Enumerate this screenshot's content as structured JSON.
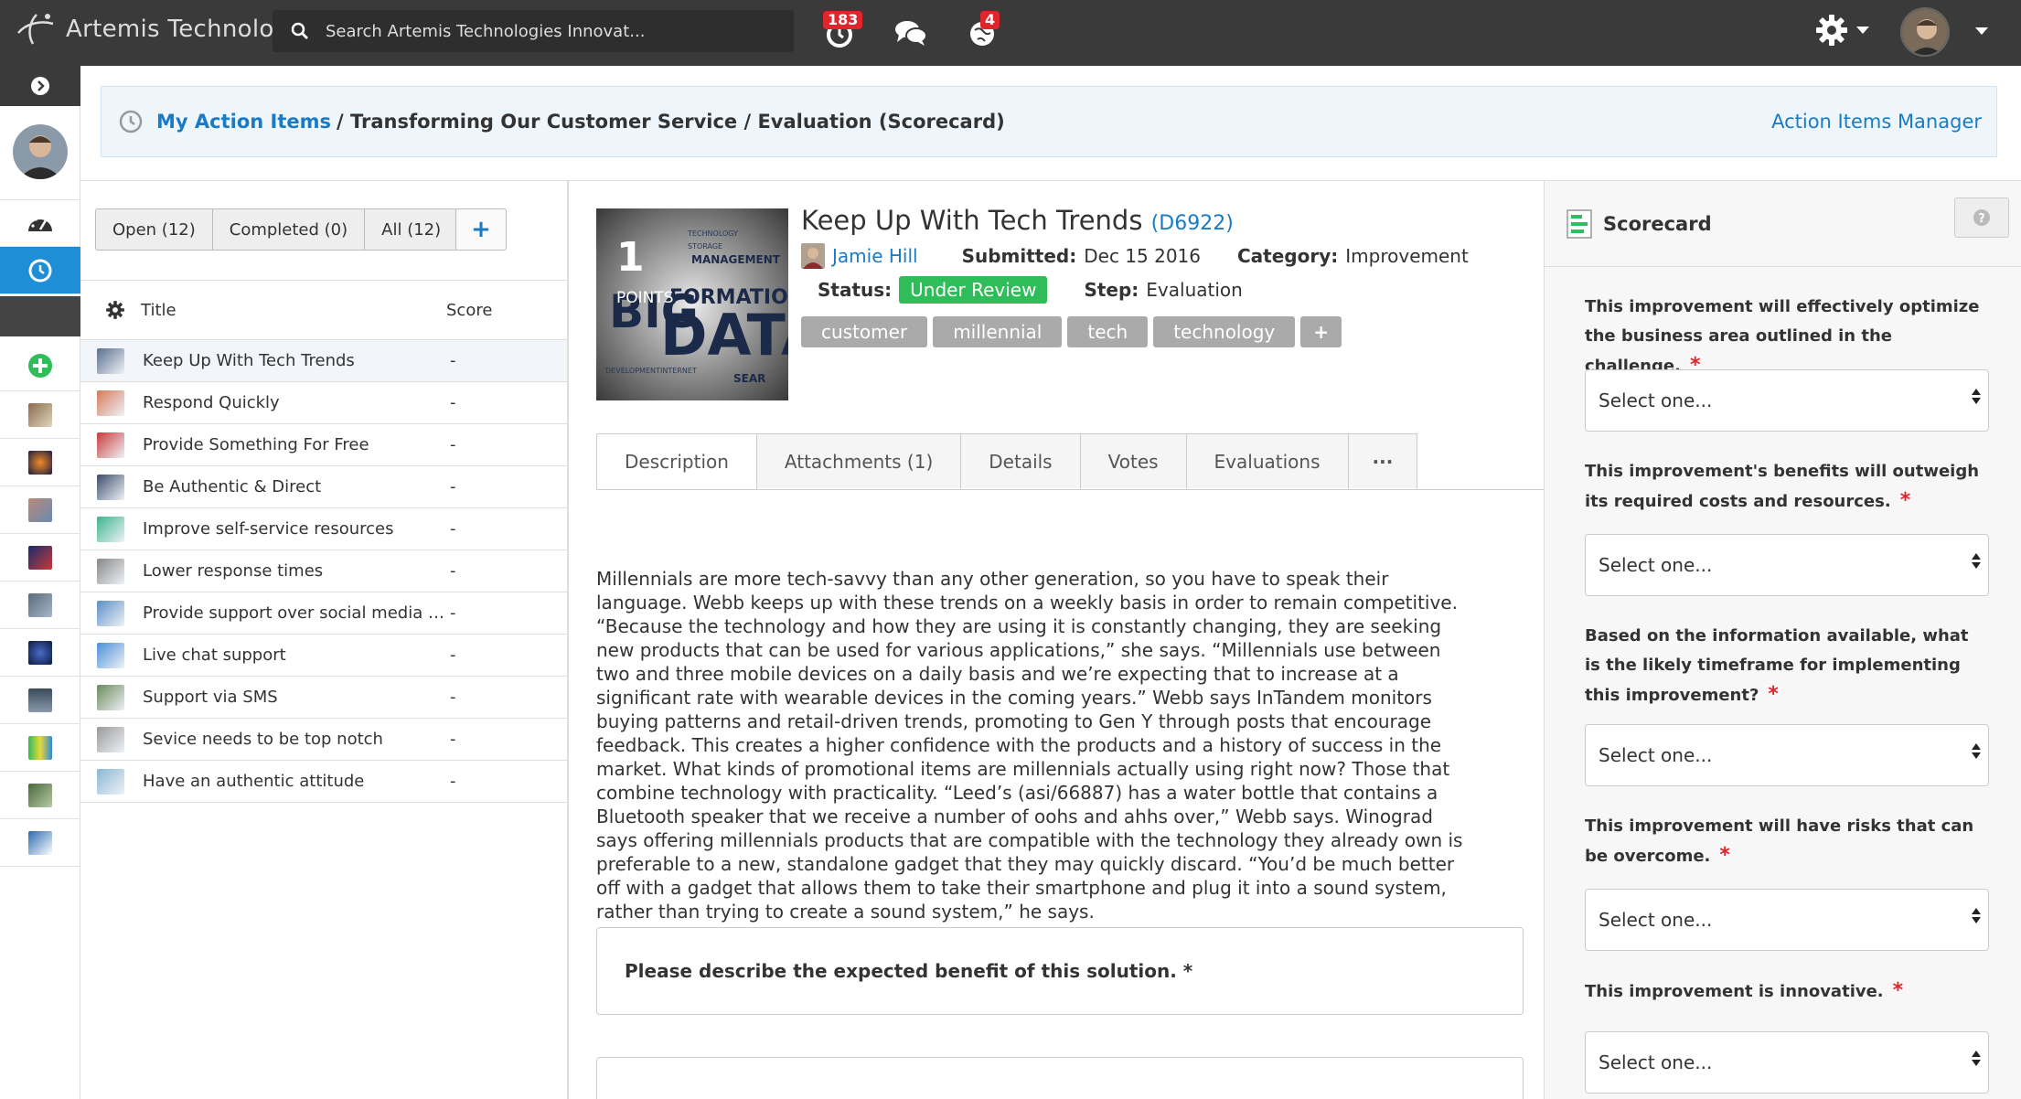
{
  "app": {
    "name": "Artemis Technologies",
    "search_placeholder": "Search Artemis Technologies Innovat...",
    "notifications": {
      "activity_count": "183",
      "messages_count": "",
      "ideas_count": "4"
    }
  },
  "breadcrumb": {
    "link": "My Action Items",
    "path": "/ Transforming Our Customer Service / Evaluation (Scorecard)",
    "right_link": "Action Items Manager"
  },
  "list": {
    "filters": [
      "Open (12)",
      "Completed (0)",
      "All (12)"
    ],
    "add_label": "+",
    "columns": {
      "title": "Title",
      "score": "Score"
    },
    "rows": [
      {
        "title": "Keep Up With Tech Trends",
        "score": "-",
        "color": "#5a6f8f"
      },
      {
        "title": "Respond Quickly",
        "score": "-",
        "color": "#d77a5a"
      },
      {
        "title": "Provide Something For Free",
        "score": "-",
        "color": "#c93a3a"
      },
      {
        "title": "Be Authentic & Direct",
        "score": "-",
        "color": "#3b4d6b"
      },
      {
        "title": "Improve self-service resources",
        "score": "-",
        "color": "#3cb58c"
      },
      {
        "title": "Lower response times",
        "score": "-",
        "color": "#888888"
      },
      {
        "title": "Provide support over social media c...",
        "score": "-",
        "color": "#5b8fc6"
      },
      {
        "title": "Live chat support",
        "score": "-",
        "color": "#4a90d9"
      },
      {
        "title": "Support via SMS",
        "score": "-",
        "color": "#6a8a5a"
      },
      {
        "title": "Sevice needs to be top notch",
        "score": "-",
        "color": "#9a9a9a"
      },
      {
        "title": "Have an authentic attitude",
        "score": "-",
        "color": "#8ab6d6"
      }
    ]
  },
  "detail": {
    "points": "1",
    "points_label": "POINTS",
    "title": "Keep Up With Tech Trends",
    "id_open": "(",
    "id": "D6922",
    "id_close": ")",
    "author": "Jamie Hill",
    "submitted_label": "Submitted:",
    "submitted": "Dec 15 2016",
    "category_label": "Category:",
    "category": "Improvement",
    "status_label": "Status:",
    "status": "Under Review",
    "step_label": "Step:",
    "step": "Evaluation",
    "tags": [
      "customer",
      "millennial",
      "tech",
      "technology"
    ],
    "tag_add": "+",
    "tabs": [
      "Description",
      "Attachments (1)",
      "Details",
      "Votes",
      "Evaluations",
      "···"
    ],
    "description": "Millennials are more tech-savvy than any other generation, so you have to speak their language. Webb keeps up with these trends on a weekly basis in order to remain competitive. “Because the technology and how they are using it is constantly changing, they are seeking new products that can be used for various applications,” she says. “Millennials use between two and three mobile devices on a daily basis and we’re expecting that to increase at a significant rate with wearable devices in the coming years.” Webb says InTandem monitors buying patterns and retail-driven trends, promoting to Gen Y through posts that encourage feedback. This creates a higher confidence with the products and a history of success in the market. What kinds of promotional items are millennials actually using right now? Those that combine technology with practicality. “Leed’s (asi/66887) has a water bottle that contains a Bluetooth speaker that we receive a number of oohs and ahhs over,” Webb says. Winograd says offering millennials products that are compatible with the technology they already own is preferable to a new, standalone gadget that they may quickly discard. “You’d be much better off with a gadget that allows them to take their smartphone and plug it into a sound system, rather than trying to create a sound system,” he says.",
    "benefit_prompt": "Please describe the expected benefit of this solution. *"
  },
  "scorecard": {
    "title": "Scorecard",
    "questions": [
      {
        "text": "This improvement will effectively optimize the business area outlined in the challenge.",
        "select": "Select one..."
      },
      {
        "text": "This improvement's benefits will outweigh its required costs and resources.",
        "select": "Select one..."
      },
      {
        "text": "Based on the information available, what is the likely timeframe for implementing this improvement?",
        "select": "Select one..."
      },
      {
        "text": "This improvement will have risks that can be overcome.",
        "select": "Select one..."
      },
      {
        "text": "This improvement is innovative.",
        "select": "Select one..."
      }
    ],
    "required_mark": "*"
  },
  "colors": {
    "accent": "#1a7bc4",
    "topbar": "#3a3a3a",
    "status_green": "#2ebd59",
    "badge_red": "#e0262b",
    "tag_gray": "#aaaaaa"
  }
}
